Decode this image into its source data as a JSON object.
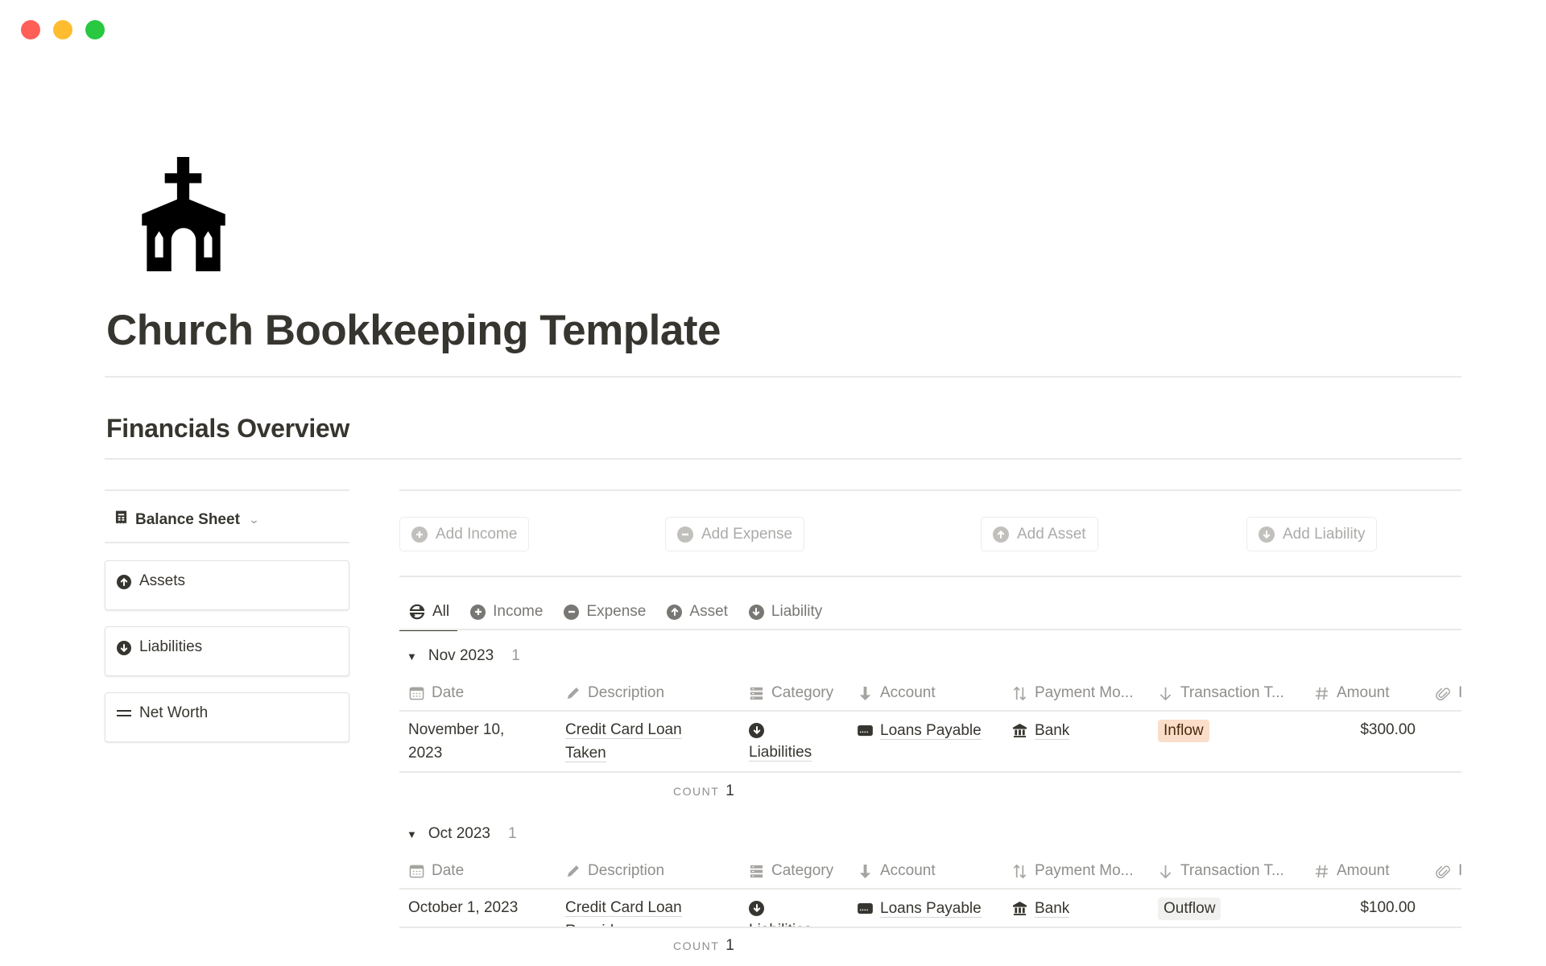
{
  "window": {
    "traffic_lights": [
      {
        "name": "close",
        "color": "#ff5f57"
      },
      {
        "name": "minimize",
        "color": "#febc2e"
      },
      {
        "name": "zoom",
        "color": "#28c840"
      }
    ]
  },
  "page": {
    "icon": "church-icon",
    "title": "Church Bookkeeping Template",
    "section_heading": "Financials Overview"
  },
  "left_panel": {
    "view_switcher": {
      "icon": "receipt-icon",
      "label": "Balance Sheet",
      "chevron": "chevron-down-icon"
    },
    "cards": [
      {
        "icon": "arrow-up-circle-icon",
        "label": "Assets"
      },
      {
        "icon": "arrow-down-circle-icon",
        "label": "Liabilities"
      },
      {
        "icon": "equals-icon",
        "label": "Net Worth"
      }
    ]
  },
  "actions": {
    "buttons": [
      {
        "icon": "plus-circle-icon",
        "label": "Add Income"
      },
      {
        "icon": "minus-circle-icon",
        "label": "Add Expense"
      },
      {
        "icon": "arrow-up-circle-icon",
        "label": "Add Asset"
      },
      {
        "icon": "arrow-down-circle-icon",
        "label": "Add Liability"
      }
    ]
  },
  "tabs": [
    {
      "icon": "arrows-exchange-icon",
      "label": "All",
      "active": true
    },
    {
      "icon": "plus-circle-icon",
      "label": "Income",
      "active": false
    },
    {
      "icon": "minus-circle-icon",
      "label": "Expense",
      "active": false
    },
    {
      "icon": "arrow-up-circle-icon",
      "label": "Asset",
      "active": false
    },
    {
      "icon": "arrow-down-circle-icon",
      "label": "Liability",
      "active": false
    }
  ],
  "table": {
    "columns": [
      {
        "icon": "calendar-icon",
        "label": "Date"
      },
      {
        "icon": "pencil-icon",
        "label": "Description"
      },
      {
        "icon": "list-icon",
        "label": "Category"
      },
      {
        "icon": "arrow-down-bold-icon",
        "label": "Account"
      },
      {
        "icon": "arrows-up-down-icon",
        "label": "Payment Mo..."
      },
      {
        "icon": "arrow-down-thin-icon",
        "label": "Transaction T..."
      },
      {
        "icon": "hash-icon",
        "label": "Amount"
      },
      {
        "icon": "paperclip-icon",
        "label": "I"
      }
    ],
    "groups": [
      {
        "label": "Nov 2023",
        "count": "1",
        "rows": [
          {
            "date": "November 10, 2023",
            "date_line1": "November 10,",
            "date_line2": "2023",
            "description_line1": "Credit Card Loan",
            "description_line2": "Taken",
            "category": "Liabilities",
            "account": "Loans Payable",
            "payment_mode": "Bank",
            "transaction_type": "Inflow",
            "transaction_type_color": "#fadec9",
            "amount": "$300.00"
          }
        ],
        "footer_label": "COUNT",
        "footer_value": "1"
      },
      {
        "label": "Oct 2023",
        "count": "1",
        "rows": [
          {
            "date": "October 1, 2023",
            "description_line1": "Credit Card Loan",
            "description_line2": "Repaid",
            "category": "Liabilities",
            "account": "Loans Payable",
            "payment_mode": "Bank",
            "transaction_type": "Outflow",
            "transaction_type_color": "#f1f1ef",
            "amount": "$100.00"
          }
        ],
        "footer_label": "COUNT",
        "footer_value": "1"
      }
    ]
  }
}
